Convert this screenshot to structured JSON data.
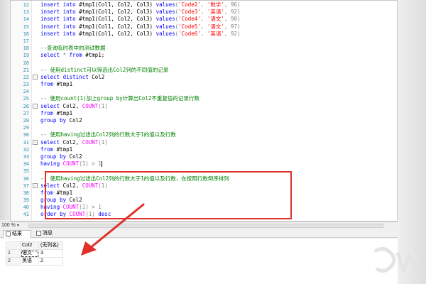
{
  "editor": {
    "lines": [
      {
        "num": "12",
        "fold": "",
        "segs": [
          [
            "kw",
            "insert into"
          ],
          [
            "",
            " #tmp1(Col1, Col2, Col3) "
          ],
          [
            "kw",
            "values"
          ],
          [
            "gr",
            "("
          ],
          [
            "str",
            "'Code2'"
          ],
          [
            "gr",
            ", "
          ],
          [
            "str",
            "'数学'"
          ],
          [
            "gr",
            ", 96)"
          ]
        ]
      },
      {
        "num": "13",
        "fold": "",
        "segs": [
          [
            "kw",
            "insert into"
          ],
          [
            "",
            " #tmp1(Col1, Col2, Col3) "
          ],
          [
            "kw",
            "values"
          ],
          [
            "gr",
            "("
          ],
          [
            "str",
            "'Code3'"
          ],
          [
            "gr",
            ", "
          ],
          [
            "str",
            "'英语'"
          ],
          [
            "gr",
            ", 92)"
          ]
        ]
      },
      {
        "num": "14",
        "fold": "",
        "segs": [
          [
            "kw",
            "insert into"
          ],
          [
            "",
            " #tmp1(Col1, Col2, Col3) "
          ],
          [
            "kw",
            "values"
          ],
          [
            "gr",
            "("
          ],
          [
            "str",
            "'Code4'"
          ],
          [
            "gr",
            ", "
          ],
          [
            "str",
            "'语文'"
          ],
          [
            "gr",
            ", 90)"
          ]
        ]
      },
      {
        "num": "15",
        "fold": "",
        "segs": [
          [
            "kw",
            "insert into"
          ],
          [
            "",
            " #tmp1(Col1, Col2, Col3) "
          ],
          [
            "kw",
            "values"
          ],
          [
            "gr",
            "("
          ],
          [
            "str",
            "'Code5'"
          ],
          [
            "gr",
            ", "
          ],
          [
            "str",
            "'语文'"
          ],
          [
            "gr",
            ", 97)"
          ]
        ]
      },
      {
        "num": "16",
        "fold": "",
        "segs": [
          [
            "kw",
            "insert into"
          ],
          [
            "",
            " #tmp1(Col1, Col2, Col3) "
          ],
          [
            "kw",
            "values"
          ],
          [
            "gr",
            "("
          ],
          [
            "str",
            "'Code6'"
          ],
          [
            "gr",
            ", "
          ],
          [
            "str",
            "'英语'"
          ],
          [
            "gr",
            ", 92)"
          ]
        ]
      },
      {
        "num": "17",
        "fold": "",
        "segs": []
      },
      {
        "num": "18",
        "fold": "",
        "segs": [
          [
            "cm",
            "--查询临时表中的测试数据"
          ]
        ]
      },
      {
        "num": "19",
        "fold": "",
        "segs": [
          [
            "kw",
            "select"
          ],
          [
            "gr",
            " * "
          ],
          [
            "kw",
            "from"
          ],
          [
            "",
            " #tmp1;"
          ]
        ]
      },
      {
        "num": "20",
        "fold": "",
        "segs": []
      },
      {
        "num": "21",
        "fold": "",
        "segs": [
          [
            "cm",
            "-- 使用distinct可以筛选出Col2列的不同值的记录"
          ]
        ]
      },
      {
        "num": "22",
        "fold": "-",
        "segs": [
          [
            "kw",
            "select distinct"
          ],
          [
            "",
            " Col2"
          ]
        ]
      },
      {
        "num": "23",
        "fold": "",
        "segs": [
          [
            "kw",
            "from"
          ],
          [
            "",
            " #tmp1"
          ]
        ]
      },
      {
        "num": "24",
        "fold": "",
        "segs": []
      },
      {
        "num": "25",
        "fold": "",
        "segs": [
          [
            "cm",
            "-- 使用count(1)加上group by计算出Col2不重复值的记录行数"
          ]
        ]
      },
      {
        "num": "26",
        "fold": "-",
        "segs": [
          [
            "kw",
            "select"
          ],
          [
            "",
            " Col2, "
          ],
          [
            "fn",
            "COUNT"
          ],
          [
            "gr",
            "(1)"
          ]
        ]
      },
      {
        "num": "27",
        "fold": "",
        "segs": [
          [
            "kw",
            "from"
          ],
          [
            "",
            " #tmp1"
          ]
        ]
      },
      {
        "num": "28",
        "fold": "",
        "segs": [
          [
            "kw",
            "group by"
          ],
          [
            "",
            " Col2"
          ]
        ]
      },
      {
        "num": "29",
        "fold": "",
        "segs": []
      },
      {
        "num": "30",
        "fold": "",
        "segs": [
          [
            "cm",
            "-- 使用having过滤出Col2列的行数大于1的值以及行数"
          ]
        ]
      },
      {
        "num": "31",
        "fold": "-",
        "segs": [
          [
            "kw",
            "select"
          ],
          [
            "",
            " Col2, "
          ],
          [
            "fn",
            "COUNT"
          ],
          [
            "gr",
            "(1)"
          ]
        ]
      },
      {
        "num": "32",
        "fold": "",
        "segs": [
          [
            "kw",
            "from"
          ],
          [
            "",
            " #tmp1"
          ]
        ]
      },
      {
        "num": "33",
        "fold": "",
        "segs": [
          [
            "kw",
            "group by"
          ],
          [
            "",
            " Col2"
          ]
        ]
      },
      {
        "num": "34",
        "fold": "",
        "segs": [
          [
            "kw",
            "having"
          ],
          [
            "",
            " "
          ],
          [
            "fn",
            "COUNT"
          ],
          [
            "gr",
            "(1) > 1"
          ],
          [
            "caret",
            ""
          ]
        ]
      },
      {
        "num": "35",
        "fold": "",
        "segs": []
      },
      {
        "num": "36",
        "fold": "",
        "segs": [
          [
            "cm",
            "-- 使用having过滤出Col2列的行数大于1的值以及行数，在按照行数倒序排列"
          ]
        ]
      },
      {
        "num": "37",
        "fold": "-",
        "segs": [
          [
            "kw",
            "select"
          ],
          [
            "",
            " Col2, "
          ],
          [
            "fn",
            "COUNT"
          ],
          [
            "gr",
            "(1)"
          ]
        ]
      },
      {
        "num": "38",
        "fold": "",
        "segs": [
          [
            "kw",
            "from"
          ],
          [
            "",
            " #tmp1"
          ]
        ]
      },
      {
        "num": "39",
        "fold": "",
        "segs": [
          [
            "kw",
            "group by"
          ],
          [
            "",
            " Col2"
          ]
        ]
      },
      {
        "num": "40",
        "fold": "",
        "segs": [
          [
            "kw",
            "having"
          ],
          [
            "",
            " "
          ],
          [
            "fn",
            "COUNT"
          ],
          [
            "gr",
            "(1) > 1"
          ]
        ]
      },
      {
        "num": "41",
        "fold": "",
        "segs": [
          [
            "kw",
            "order by"
          ],
          [
            "",
            " "
          ],
          [
            "fn",
            "COUNT"
          ],
          [
            "gr",
            "(1) "
          ],
          [
            "kw",
            "desc"
          ]
        ]
      }
    ]
  },
  "statusbar": {
    "zoom": "100 %"
  },
  "result_tabs": {
    "results_label": "结果",
    "messages_label": "消息"
  },
  "results_grid": {
    "columns": [
      "Col2",
      "(无列名)"
    ],
    "rows": [
      {
        "num": "1",
        "cells": [
          "语文",
          "3"
        ]
      },
      {
        "num": "2",
        "cells": [
          "英语",
          "2"
        ]
      }
    ]
  },
  "colors": {
    "keyword": "#0000ff",
    "string": "#ff0000",
    "comment": "#008000",
    "function": "#ff00ff",
    "highlight_box": "#e0302a",
    "arrow": "#e0302a"
  },
  "icons": {
    "results_tab_icon": "grid-icon",
    "messages_tab_icon": "message-icon",
    "fold_marker": "collapse-icon",
    "annotation_arrow": "arrow-icon"
  }
}
